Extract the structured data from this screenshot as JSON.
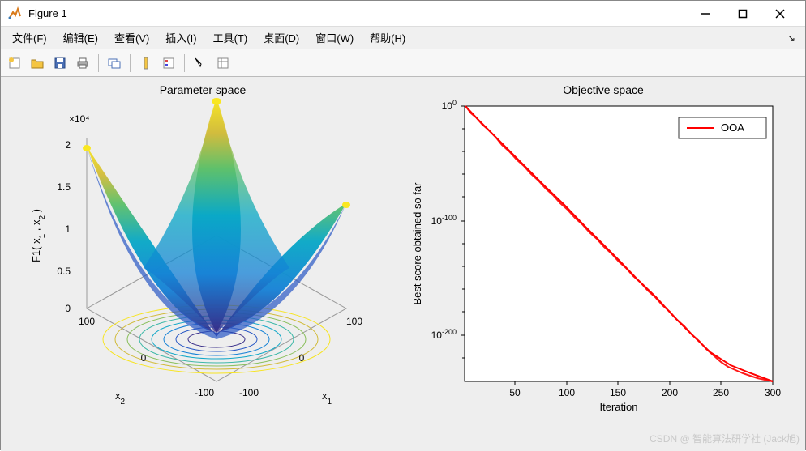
{
  "window": {
    "title": "Figure 1"
  },
  "menu": {
    "file": "文件(F)",
    "edit": "编辑(E)",
    "view": "查看(V)",
    "insert": "插入(I)",
    "tools": "工具(T)",
    "desktop": "桌面(D)",
    "window": "窗口(W)",
    "help": "帮助(H)"
  },
  "watermark": "CSDN @ 智能算法研学社 (Jack旭)",
  "chart_data": [
    {
      "type": "surface",
      "title": "Parameter space",
      "xlabel": "x₁",
      "ylabel": "x₂",
      "zlabel": "F1( x₁ , x₂ )",
      "z_multiplier_label": "×10⁴",
      "x_range": [
        -100,
        100
      ],
      "y_range": [
        -100,
        100
      ],
      "z_range": [
        0,
        2
      ],
      "x_ticks": [
        -100,
        0,
        100
      ],
      "y_ticks": [
        -100,
        0,
        100
      ],
      "z_ticks": [
        0,
        0.5,
        1,
        1.5,
        2
      ],
      "function": "F1(x1,x2) = x1^2 + x2^2",
      "colormap": "parula"
    },
    {
      "type": "line",
      "title": "Objective space",
      "xlabel": "Iteration",
      "ylabel": "Best score obtained so far",
      "xlim": [
        1,
        300
      ],
      "ylim_log10": [
        -240,
        0
      ],
      "x_ticks": [
        50,
        100,
        150,
        200,
        250,
        300
      ],
      "y_tick_exponents": [
        0,
        -100,
        -200
      ],
      "series": [
        {
          "name": "OOA",
          "color": "#ff0000",
          "x": [
            1,
            50,
            100,
            150,
            200,
            250,
            300
          ],
          "y_log10": [
            0,
            -40,
            -80,
            -120,
            -160,
            -200,
            -240
          ]
        }
      ]
    }
  ]
}
